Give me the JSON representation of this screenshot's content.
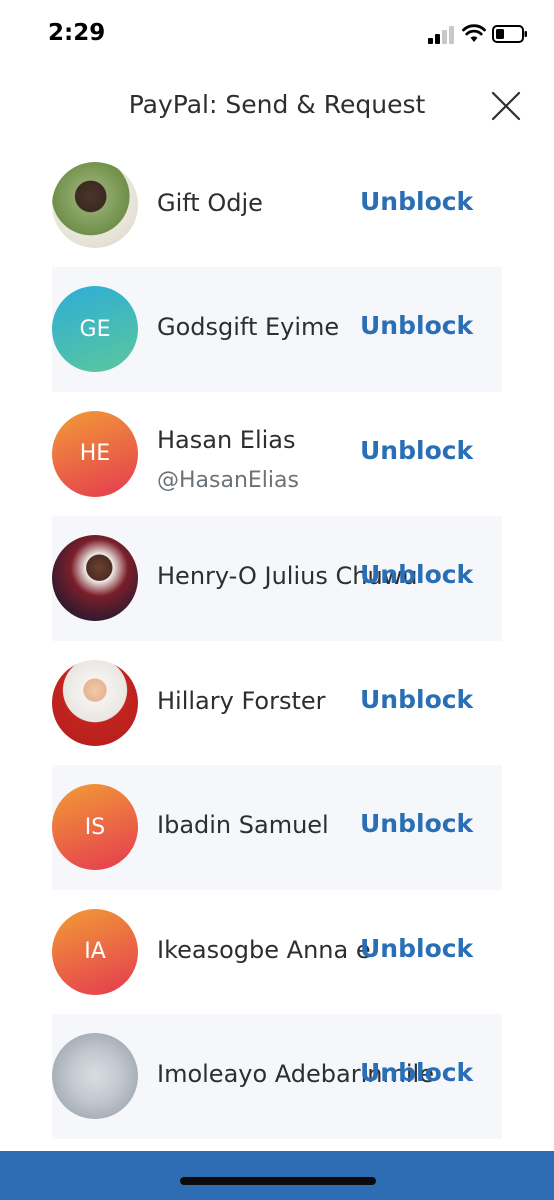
{
  "status_bar": {
    "time": "2:29"
  },
  "header": {
    "title": "PayPal: Send & Request"
  },
  "contacts": [
    {
      "name": "",
      "handle": "",
      "initials": "",
      "avatar": "photo-partial",
      "action": ""
    },
    {
      "name": "Gift Odje",
      "handle": "",
      "initials": "",
      "avatar": "photo",
      "action": "Unblock"
    },
    {
      "name": "Godsgift Eyime",
      "handle": "",
      "initials": "GE",
      "avatar": "teal",
      "action": "Unblock"
    },
    {
      "name": "Hasan Elias",
      "handle": "@HasanElias",
      "initials": "HE",
      "avatar": "orange",
      "action": "Unblock"
    },
    {
      "name": "Henry-O Julius Chuwu",
      "handle": "",
      "initials": "",
      "avatar": "photo",
      "action": "Unblock"
    },
    {
      "name": "Hillary Forster",
      "handle": "",
      "initials": "",
      "avatar": "photo",
      "action": "Unblock"
    },
    {
      "name": "Ibadin Samuel",
      "handle": "",
      "initials": "IS",
      "avatar": "orange",
      "action": "Unblock"
    },
    {
      "name": "Ikeasogbe Anna e",
      "handle": "",
      "initials": "IA",
      "avatar": "orange",
      "action": "Unblock"
    },
    {
      "name": "Imoleayo Adebarinmile",
      "handle": "",
      "initials": "",
      "avatar": "photo",
      "action": "Unblock"
    }
  ],
  "colors": {
    "link": "#2a6fb5",
    "bottom_bar": "#2e6db4",
    "row_shade": "#f5f7fa"
  }
}
